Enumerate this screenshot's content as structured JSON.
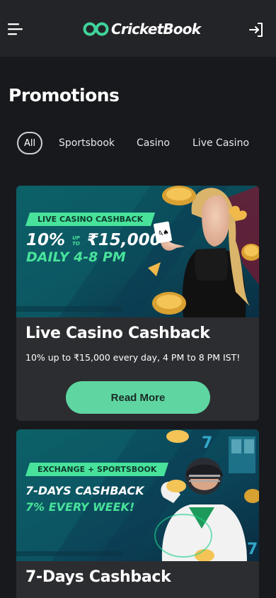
{
  "header": {
    "logo_text": "CricketBook",
    "menu_icon": "hamburger-menu-icon",
    "login_icon": "login-icon"
  },
  "page": {
    "title": "Promotions"
  },
  "filters": [
    "All",
    "Sportsbook",
    "Casino",
    "Live Casino"
  ],
  "promotions": [
    {
      "banner_tag": "LIVE CASINO CASHBACK",
      "banner_line1": "10%",
      "banner_upto_top": "UP",
      "banner_upto_bottom": "TO",
      "banner_amount": "₹15,000",
      "banner_line2": "DAILY 4-8 PM",
      "title": "Live Casino Cashback",
      "description": "10% up to ₹15,000 every day, 4 PM to 8 PM IST!",
      "button": "Read More"
    },
    {
      "banner_tag": "EXCHANGE + SPORTSBOOK",
      "banner_line1": "7-DAYS CASHBACK",
      "banner_line2": "7% EVERY WEEK!",
      "title": "7-Days Cashback"
    }
  ],
  "colors": {
    "background": "#18191c",
    "header": "#232427",
    "card": "#2c2d30",
    "accent": "#5fd6a2",
    "banner_green": "#48e29b"
  }
}
